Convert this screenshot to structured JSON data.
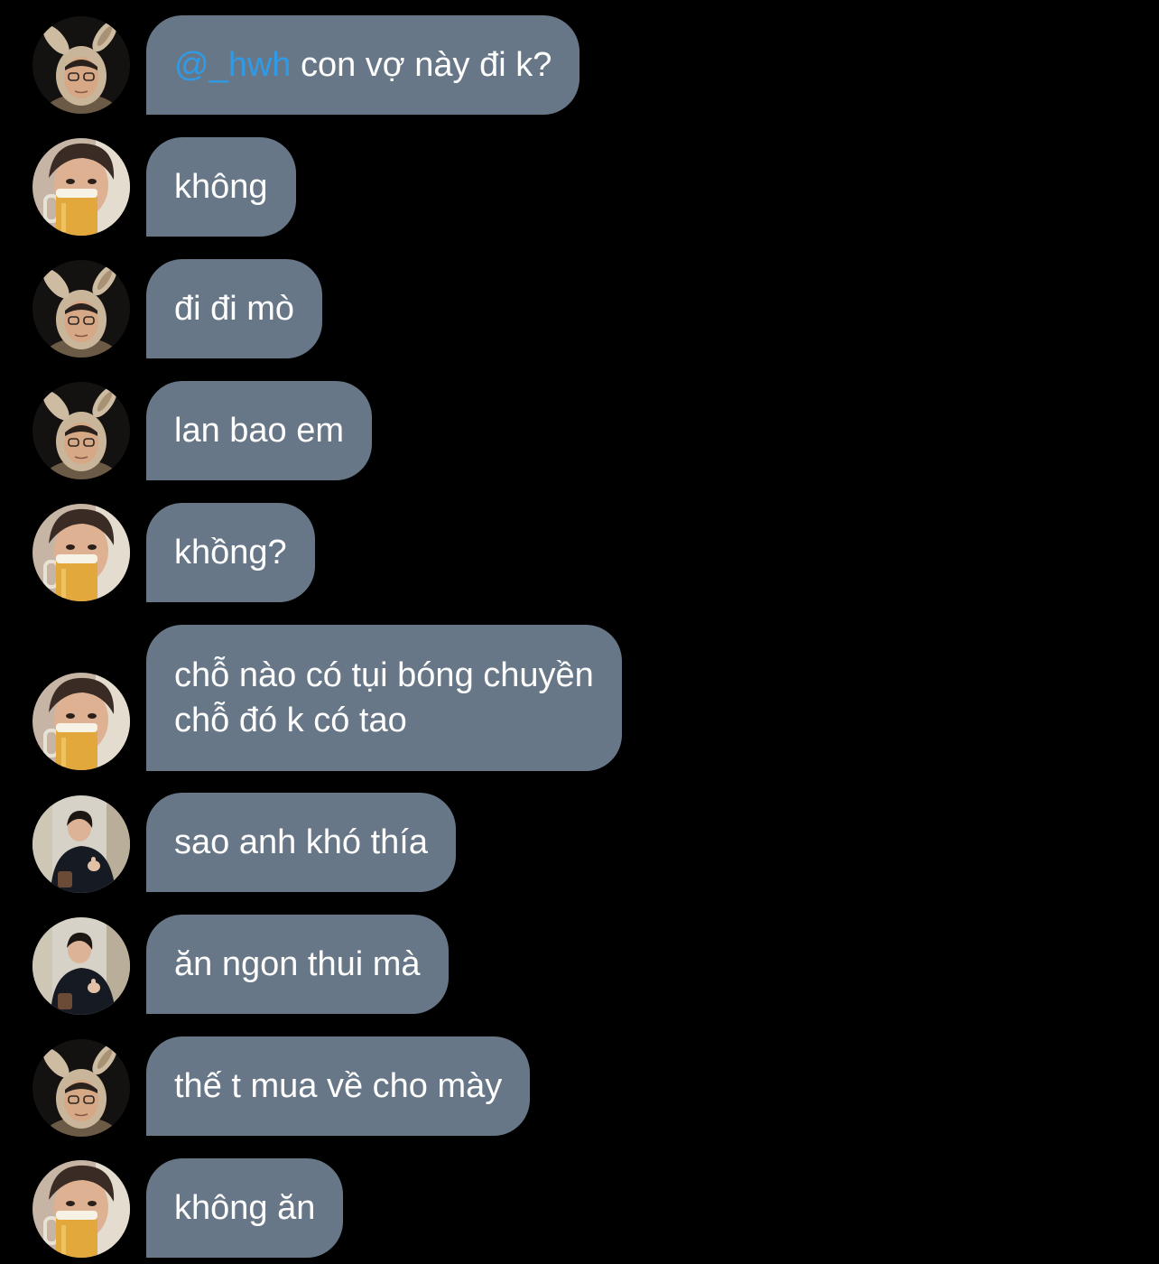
{
  "messages": [
    {
      "avatar": "bunny-ears-avatar",
      "mention": "@_hwh",
      "text": " con vợ này đi k?"
    },
    {
      "avatar": "beer-glass-avatar",
      "text": "không"
    },
    {
      "avatar": "bunny-ears-avatar",
      "text": "đi đi mò"
    },
    {
      "avatar": "bunny-ears-avatar",
      "text": "lan bao em"
    },
    {
      "avatar": "beer-glass-avatar",
      "text": "khồng?"
    },
    {
      "avatar": "beer-glass-avatar",
      "lines": [
        "chỗ nào có tụi bóng chuyền",
        "chỗ đó k có tao"
      ]
    },
    {
      "avatar": "thumbs-up-avatar",
      "text": "sao anh khó thía"
    },
    {
      "avatar": "thumbs-up-avatar",
      "text": "ăn ngon thui mà"
    },
    {
      "avatar": "bunny-ears-avatar",
      "text": "thế t mua về cho mày"
    },
    {
      "avatar": "beer-glass-avatar",
      "text": "không ăn"
    }
  ],
  "colors": {
    "background": "#000000",
    "bubble": "#687787",
    "bubble_text": "#ffffff",
    "mention": "#2f9be7"
  }
}
